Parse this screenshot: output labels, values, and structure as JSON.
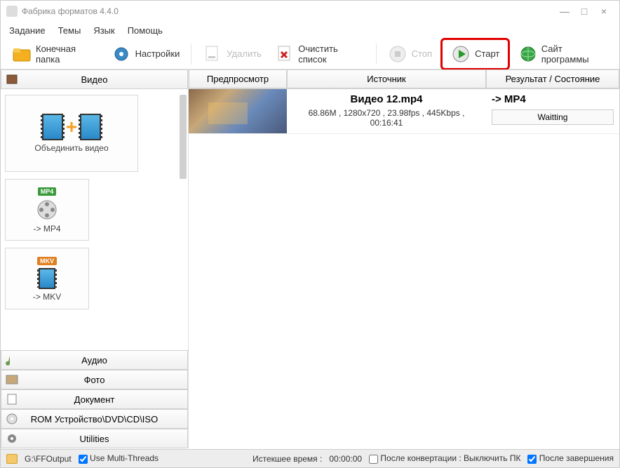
{
  "title": "Фабрика форматов 4.4.0",
  "menu": {
    "task": "Задание",
    "themes": "Темы",
    "lang": "Язык",
    "help": "Помощь"
  },
  "toolbar": {
    "output_folder": "Конечная папка",
    "settings": "Настройки",
    "delete": "Удалить",
    "clear_list": "Очистить список",
    "stop": "Стоп",
    "start": "Старт",
    "site": "Сайт программы"
  },
  "categories": {
    "video": "Видео",
    "audio": "Аудио",
    "photo": "Фото",
    "document": "Документ",
    "rom": "ROM Устройство\\DVD\\CD\\ISO",
    "utilities": "Utilities"
  },
  "formats": {
    "merge": "Объединить видео",
    "mp4": "-> MP4",
    "mkv": "-> MKV",
    "mp4_badge": "MP4",
    "mkv_badge": "MKV"
  },
  "columns": {
    "preview": "Предпросмотр",
    "source": "Источник",
    "result": "Результат / Состояние"
  },
  "item": {
    "filename": "Видео 12.mp4",
    "meta": "68.86M , 1280x720 , 23.98fps , 445Kbps , 00:16:41",
    "target": "-> MP4",
    "status": "Waitting"
  },
  "status": {
    "output_path": "G:\\FFOutput",
    "multi_threads": "Use Multi-Threads",
    "elapsed_label": "Истекшее время :",
    "elapsed_value": "00:00:00",
    "after_convert": "После конвертации : Выключить ПК",
    "after_done": "После завершения"
  }
}
